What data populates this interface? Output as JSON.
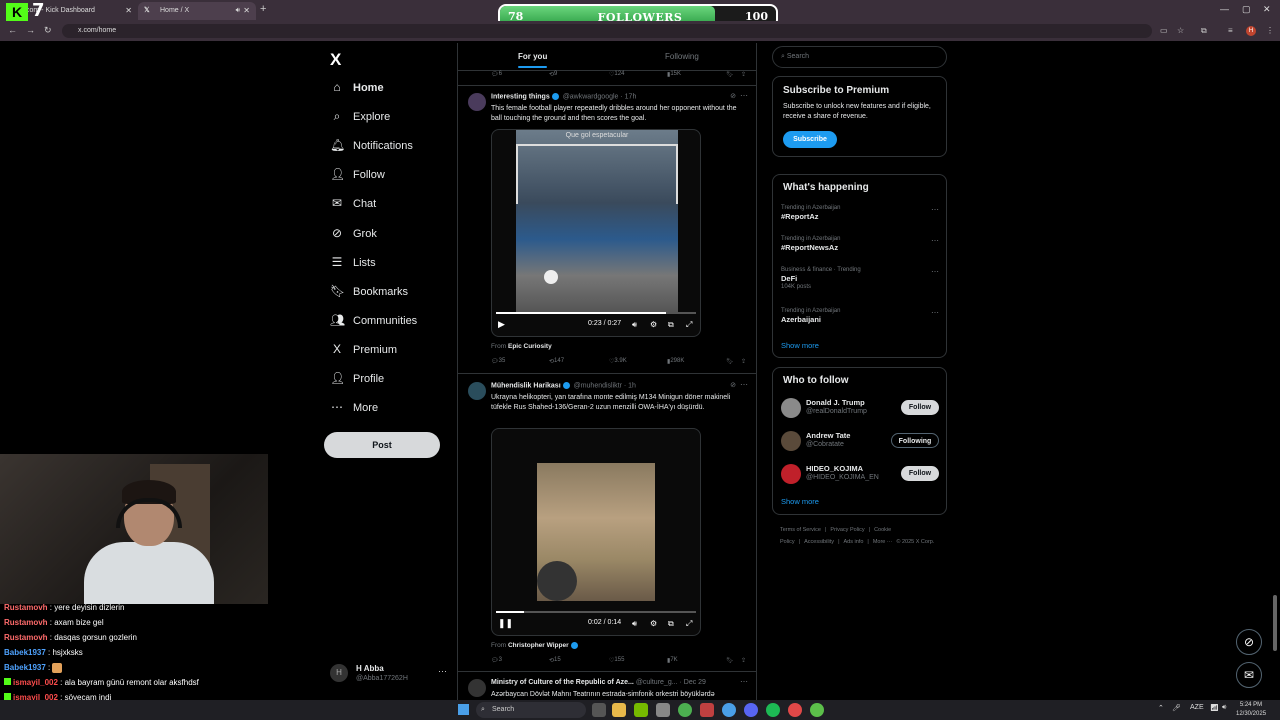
{
  "browser": {
    "tabs": [
      {
        "title": "com - Kick Dashboard"
      },
      {
        "title": "Home / X"
      }
    ],
    "url": "x.com/home",
    "kick_logo": "K",
    "overlay_number": "7"
  },
  "followers_goal": {
    "label": "FOLLOWERS",
    "current": "78",
    "goal": "100",
    "progress_fraction": 0.78
  },
  "nav": {
    "logo": "X",
    "items": [
      {
        "label": "Home",
        "icon": "home-icon",
        "glyph": "⌂"
      },
      {
        "label": "Explore",
        "icon": "search-icon",
        "glyph": "⌕"
      },
      {
        "label": "Notifications",
        "icon": "bell-icon",
        "glyph": "🔔︎"
      },
      {
        "label": "Follow",
        "icon": "add-person-icon",
        "glyph": "👤︎"
      },
      {
        "label": "Chat",
        "icon": "mail-icon",
        "glyph": "✉"
      },
      {
        "label": "Grok",
        "icon": "grok-icon",
        "glyph": "⊘"
      },
      {
        "label": "Lists",
        "icon": "list-icon",
        "glyph": "☰"
      },
      {
        "label": "Bookmarks",
        "icon": "bookmark-icon",
        "glyph": "🔖︎"
      },
      {
        "label": "Communities",
        "icon": "communities-icon",
        "glyph": "👥︎"
      },
      {
        "label": "Premium",
        "icon": "x-icon",
        "glyph": "X"
      },
      {
        "label": "Profile",
        "icon": "person-icon",
        "glyph": "👤︎"
      },
      {
        "label": "More",
        "icon": "more-circle-icon",
        "glyph": "⋯"
      }
    ],
    "post_button": "Post",
    "account": {
      "name": "H Abba",
      "handle": "@Abba177262H",
      "initial": "H"
    }
  },
  "chat": [
    {
      "user": "Rustamovh",
      "msg": "yere deyisin dizlerin",
      "color": "#ff6b6b",
      "badge": false
    },
    {
      "user": "Rustamovh",
      "msg": "axam bize gel",
      "color": "#ff6b6b",
      "badge": false
    },
    {
      "user": "Rustamovh",
      "msg": "dasqas gorsun gozlerin",
      "color": "#ff6b6b",
      "badge": false
    },
    {
      "user": "Babek1937",
      "msg": "hsjxksks",
      "color": "#4fa3ff",
      "badge": false
    },
    {
      "user": "Babek1937",
      "msg": "",
      "color": "#4fa3ff",
      "badge": false,
      "emoji": true
    },
    {
      "user": "ismayil_002",
      "msg": "ala bayram günü remont olar aksfhdsf",
      "color": "#ff4d4d",
      "badge": true
    },
    {
      "user": "ismayil_002",
      "msg": "söyecam indi",
      "color": "#ff4d4d",
      "badge": true
    },
    {
      "user": "Babek1937",
      "msg": "",
      "color": "#4fa3ff",
      "badge": false,
      "emoji": true
    }
  ],
  "timeline": {
    "tabs": [
      "For you",
      "Following"
    ],
    "prev_actions": {
      "replies": "6",
      "reposts": "9",
      "likes": "124",
      "views": "15K"
    },
    "posts": [
      {
        "name": "Interesting things",
        "handle": "@awkwardgoogle · 17h",
        "text": "This female football player repeatedly dribbles around her opponent without the ball touching the ground and then scores the goal.",
        "video_caption": "Que gol espetacular",
        "video_time": "0:23 / 0:27",
        "video_progress": 0.85,
        "paused": true,
        "from": "Epic Curiosity",
        "actions": {
          "replies": "35",
          "reposts": "147",
          "likes": "3.9K",
          "views": "298K"
        }
      },
      {
        "name": "Mühendislik Harikası",
        "handle": "@muhendisliktr · 1h",
        "text": "Ukrayna helikopteri, yan tarafına monte edilmiş M134 Minigun döner makineli tüfekle Rus Shahed-136/Geran-2 uzun menzilli OWA-İHA'yı düşürdü.",
        "video_time": "0:02 / 0:14",
        "video_progress": 0.14,
        "paused": false,
        "from": "Christopher Wipper",
        "actions": {
          "replies": "3",
          "reposts": "15",
          "likes": "155",
          "views": "7K"
        }
      },
      {
        "name": "Ministry of Culture of the Republic of Aze...",
        "handle": "@culture_g... · Dec 29",
        "text": "Azərbaycan Dövlət Mahnı Teatrının estrada-simfonik orkestri böyüklərdə"
      }
    ]
  },
  "right": {
    "search_placeholder": "Search",
    "premium": {
      "title": "Subscribe to Premium",
      "text": "Subscribe to unlock new features and if eligible, receive a share of revenue.",
      "button": "Subscribe"
    },
    "happening": {
      "title": "What's happening",
      "trends": [
        {
          "context": "Trending in Azerbaijan",
          "topic": "#ReportAz",
          "count": ""
        },
        {
          "context": "Trending in Azerbaijan",
          "topic": "#ReportNewsAz",
          "count": ""
        },
        {
          "context": "Business & finance · Trending",
          "topic": "DeFi",
          "count": "104K posts"
        },
        {
          "context": "Trending in Azerbaijan",
          "topic": "Azerbaijani",
          "count": ""
        }
      ],
      "show_more": "Show more"
    },
    "who_to_follow": {
      "title": "Who to follow",
      "users": [
        {
          "name": "Donald J. Trump",
          "handle": "@realDonaldTrump",
          "button": "Follow",
          "following": false,
          "color": "#8a8a8a"
        },
        {
          "name": "Andrew Tate",
          "handle": "@Cobratate",
          "button": "Following",
          "following": true,
          "color": "#5a4a3a"
        },
        {
          "name": "HIDEO_KOJIMA",
          "handle": "@HIDEO_KOJIMA_EN",
          "button": "Follow",
          "following": false,
          "color": "#c0202a"
        }
      ],
      "show_more": "Show more"
    },
    "footer": [
      "Terms of Service",
      "|",
      "Privacy Policy",
      "|",
      "Cookie Policy",
      "|",
      "Accessibility",
      "|",
      "Ads info",
      "|",
      "More ···",
      "© 2025 X Corp."
    ]
  },
  "taskbar": {
    "search": "Search",
    "lang": "AZE",
    "time": "5:24 PM",
    "date": "12/30/2025"
  }
}
